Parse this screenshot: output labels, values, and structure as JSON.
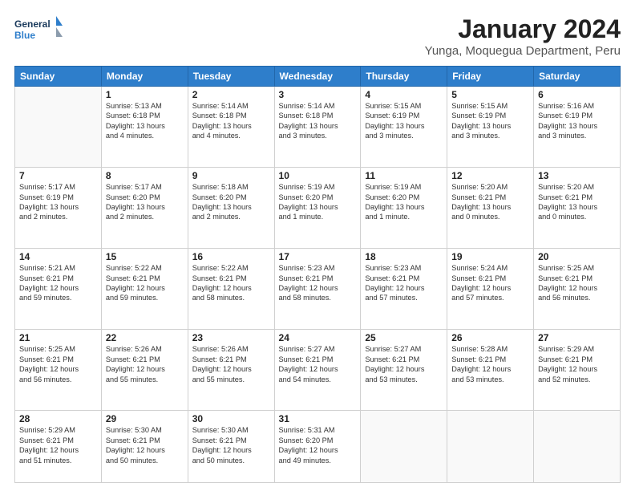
{
  "logo": {
    "line1": "General",
    "line2": "Blue"
  },
  "title": "January 2024",
  "subtitle": "Yunga, Moquegua Department, Peru",
  "headers": [
    "Sunday",
    "Monday",
    "Tuesday",
    "Wednesday",
    "Thursday",
    "Friday",
    "Saturday"
  ],
  "weeks": [
    [
      {
        "day": "",
        "info": ""
      },
      {
        "day": "1",
        "info": "Sunrise: 5:13 AM\nSunset: 6:18 PM\nDaylight: 13 hours\nand 4 minutes."
      },
      {
        "day": "2",
        "info": "Sunrise: 5:14 AM\nSunset: 6:18 PM\nDaylight: 13 hours\nand 4 minutes."
      },
      {
        "day": "3",
        "info": "Sunrise: 5:14 AM\nSunset: 6:18 PM\nDaylight: 13 hours\nand 3 minutes."
      },
      {
        "day": "4",
        "info": "Sunrise: 5:15 AM\nSunset: 6:19 PM\nDaylight: 13 hours\nand 3 minutes."
      },
      {
        "day": "5",
        "info": "Sunrise: 5:15 AM\nSunset: 6:19 PM\nDaylight: 13 hours\nand 3 minutes."
      },
      {
        "day": "6",
        "info": "Sunrise: 5:16 AM\nSunset: 6:19 PM\nDaylight: 13 hours\nand 3 minutes."
      }
    ],
    [
      {
        "day": "7",
        "info": "Sunrise: 5:17 AM\nSunset: 6:19 PM\nDaylight: 13 hours\nand 2 minutes."
      },
      {
        "day": "8",
        "info": "Sunrise: 5:17 AM\nSunset: 6:20 PM\nDaylight: 13 hours\nand 2 minutes."
      },
      {
        "day": "9",
        "info": "Sunrise: 5:18 AM\nSunset: 6:20 PM\nDaylight: 13 hours\nand 2 minutes."
      },
      {
        "day": "10",
        "info": "Sunrise: 5:19 AM\nSunset: 6:20 PM\nDaylight: 13 hours\nand 1 minute."
      },
      {
        "day": "11",
        "info": "Sunrise: 5:19 AM\nSunset: 6:20 PM\nDaylight: 13 hours\nand 1 minute."
      },
      {
        "day": "12",
        "info": "Sunrise: 5:20 AM\nSunset: 6:21 PM\nDaylight: 13 hours\nand 0 minutes."
      },
      {
        "day": "13",
        "info": "Sunrise: 5:20 AM\nSunset: 6:21 PM\nDaylight: 13 hours\nand 0 minutes."
      }
    ],
    [
      {
        "day": "14",
        "info": "Sunrise: 5:21 AM\nSunset: 6:21 PM\nDaylight: 12 hours\nand 59 minutes."
      },
      {
        "day": "15",
        "info": "Sunrise: 5:22 AM\nSunset: 6:21 PM\nDaylight: 12 hours\nand 59 minutes."
      },
      {
        "day": "16",
        "info": "Sunrise: 5:22 AM\nSunset: 6:21 PM\nDaylight: 12 hours\nand 58 minutes."
      },
      {
        "day": "17",
        "info": "Sunrise: 5:23 AM\nSunset: 6:21 PM\nDaylight: 12 hours\nand 58 minutes."
      },
      {
        "day": "18",
        "info": "Sunrise: 5:23 AM\nSunset: 6:21 PM\nDaylight: 12 hours\nand 57 minutes."
      },
      {
        "day": "19",
        "info": "Sunrise: 5:24 AM\nSunset: 6:21 PM\nDaylight: 12 hours\nand 57 minutes."
      },
      {
        "day": "20",
        "info": "Sunrise: 5:25 AM\nSunset: 6:21 PM\nDaylight: 12 hours\nand 56 minutes."
      }
    ],
    [
      {
        "day": "21",
        "info": "Sunrise: 5:25 AM\nSunset: 6:21 PM\nDaylight: 12 hours\nand 56 minutes."
      },
      {
        "day": "22",
        "info": "Sunrise: 5:26 AM\nSunset: 6:21 PM\nDaylight: 12 hours\nand 55 minutes."
      },
      {
        "day": "23",
        "info": "Sunrise: 5:26 AM\nSunset: 6:21 PM\nDaylight: 12 hours\nand 55 minutes."
      },
      {
        "day": "24",
        "info": "Sunrise: 5:27 AM\nSunset: 6:21 PM\nDaylight: 12 hours\nand 54 minutes."
      },
      {
        "day": "25",
        "info": "Sunrise: 5:27 AM\nSunset: 6:21 PM\nDaylight: 12 hours\nand 53 minutes."
      },
      {
        "day": "26",
        "info": "Sunrise: 5:28 AM\nSunset: 6:21 PM\nDaylight: 12 hours\nand 53 minutes."
      },
      {
        "day": "27",
        "info": "Sunrise: 5:29 AM\nSunset: 6:21 PM\nDaylight: 12 hours\nand 52 minutes."
      }
    ],
    [
      {
        "day": "28",
        "info": "Sunrise: 5:29 AM\nSunset: 6:21 PM\nDaylight: 12 hours\nand 51 minutes."
      },
      {
        "day": "29",
        "info": "Sunrise: 5:30 AM\nSunset: 6:21 PM\nDaylight: 12 hours\nand 50 minutes."
      },
      {
        "day": "30",
        "info": "Sunrise: 5:30 AM\nSunset: 6:21 PM\nDaylight: 12 hours\nand 50 minutes."
      },
      {
        "day": "31",
        "info": "Sunrise: 5:31 AM\nSunset: 6:20 PM\nDaylight: 12 hours\nand 49 minutes."
      },
      {
        "day": "",
        "info": ""
      },
      {
        "day": "",
        "info": ""
      },
      {
        "day": "",
        "info": ""
      }
    ]
  ]
}
